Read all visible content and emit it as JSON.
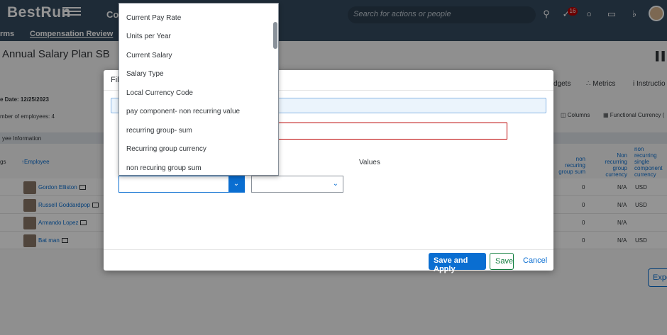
{
  "shell": {
    "logo_a": "Best",
    "logo_b": "Run",
    "app_fragment": "Co",
    "search_placeholder": "Search for actions or people",
    "notification_count": "16"
  },
  "subnav": {
    "item1": "rms",
    "item2": "Compensation Review"
  },
  "page": {
    "title": "Annual Salary Plan SB",
    "toolbar": {
      "budgets": "dgets",
      "metrics": "Metrics",
      "instructions": "Instructio"
    },
    "due_date": "e Date: 12/25/2023",
    "employee_count": "mber of employees: 4",
    "columns_btn": "Columns",
    "currency_btn": "Functional Currency (",
    "section_label": "yee Information",
    "col_gs": "gs",
    "col_employee": "Employee",
    "col_non_rec_sum": "non recuring\ngroup sum",
    "col_non_rec_ccy": "Non recurring\ngroup\ncurrency",
    "col_single": "non recurring\nsingle\ncomponent\ncurrency\ncode",
    "rows": [
      {
        "name": "Gordon Elliston",
        "sum": "0",
        "ccy": "N/A",
        "code": "USD"
      },
      {
        "name": "Russell Goddardpop",
        "sum": "0",
        "ccy": "N/A",
        "code": "USD"
      },
      {
        "name": "Armando Lopez",
        "sum": "0",
        "ccy": "N/A",
        "code": ""
      },
      {
        "name": "Bat man",
        "sum": "0",
        "ccy": "N/A",
        "code": "USD"
      }
    ],
    "export_btn": "Expo"
  },
  "dialog": {
    "title": "Fil",
    "values_label": "Values",
    "save_apply": "Save and Apply",
    "save": "Save",
    "cancel": "Cancel"
  },
  "dropdown": {
    "items": [
      "Current Pay Rate",
      "Units per Year",
      "Current Salary",
      "Salary Type",
      "Local Currency Code",
      "pay component- non recurring value",
      "recurring group- sum",
      "Recurring group currency",
      "non recuring group sum"
    ]
  },
  "colors": {
    "shell": "#354a5f",
    "accent": "#0a6ed1",
    "error": "#bb0000",
    "positive": "#107e3e"
  }
}
